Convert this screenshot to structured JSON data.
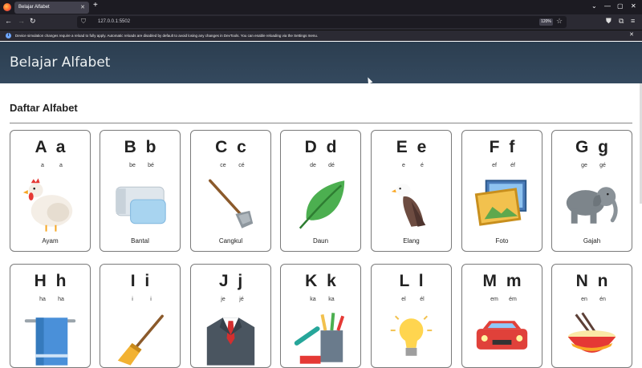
{
  "browser": {
    "tab_title": "Belajar Alfabet",
    "url": "127.0.0.1:5502",
    "zoom": "120%",
    "notification": "Device simulation changes require a reload to fully apply. Automatic reloads are disabled by default to avoid losing any changes in DevTools. You can enable reloading via the Settings menu."
  },
  "page": {
    "title": "Belajar Alfabet",
    "section_title": "Daftar Alfabet"
  },
  "cards": [
    {
      "letters": "A a",
      "pron1": "a",
      "pron2": "a",
      "word": "Ayam",
      "icon": "chicken-icon"
    },
    {
      "letters": "B b",
      "pron1": "be",
      "pron2": "bé",
      "word": "Bantal",
      "icon": "pillow-icon"
    },
    {
      "letters": "C c",
      "pron1": "ce",
      "pron2": "cé",
      "word": "Cangkul",
      "icon": "hoe-icon"
    },
    {
      "letters": "D d",
      "pron1": "de",
      "pron2": "dé",
      "word": "Daun",
      "icon": "leaf-icon"
    },
    {
      "letters": "E e",
      "pron1": "e",
      "pron2": "é",
      "word": "Elang",
      "icon": "eagle-icon"
    },
    {
      "letters": "F f",
      "pron1": "ef",
      "pron2": "éf",
      "word": "Foto",
      "icon": "photo-icon"
    },
    {
      "letters": "G g",
      "pron1": "ge",
      "pron2": "gé",
      "word": "Gajah",
      "icon": "elephant-icon"
    },
    {
      "letters": "H h",
      "pron1": "ha",
      "pron2": "ha",
      "word": "",
      "icon": "towel-icon"
    },
    {
      "letters": "I i",
      "pron1": "i",
      "pron2": "i",
      "word": "",
      "icon": "broom-icon"
    },
    {
      "letters": "J j",
      "pron1": "je",
      "pron2": "jé",
      "word": "",
      "icon": "suit-icon"
    },
    {
      "letters": "K k",
      "pron1": "ka",
      "pron2": "ka",
      "word": "",
      "icon": "pencil-cup-icon"
    },
    {
      "letters": "L l",
      "pron1": "el",
      "pron2": "él",
      "word": "",
      "icon": "lightbulb-icon"
    },
    {
      "letters": "M m",
      "pron1": "em",
      "pron2": "ém",
      "word": "",
      "icon": "car-icon"
    },
    {
      "letters": "N n",
      "pron1": "en",
      "pron2": "én",
      "word": "",
      "icon": "noodle-bowl-icon"
    }
  ]
}
